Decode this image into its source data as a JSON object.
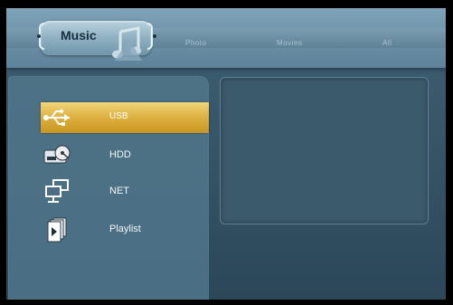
{
  "menu": {
    "tabs": [
      {
        "label": "Music",
        "active": true
      },
      {
        "label": "Photo",
        "active": false
      },
      {
        "label": "Movies",
        "active": false
      },
      {
        "label": "All",
        "active": false
      }
    ]
  },
  "sources": {
    "items": [
      {
        "label": "USB",
        "icon": "usb-icon",
        "selected": true
      },
      {
        "label": "HDD",
        "icon": "hdd-icon",
        "selected": false
      },
      {
        "label": "NET",
        "icon": "network-icon",
        "selected": false
      },
      {
        "label": "Playlist",
        "icon": "playlist-icon",
        "selected": false
      }
    ]
  },
  "colors": {
    "selection": "#deb040",
    "panel": "#4a6e83",
    "topbar": "#6f93a9"
  }
}
